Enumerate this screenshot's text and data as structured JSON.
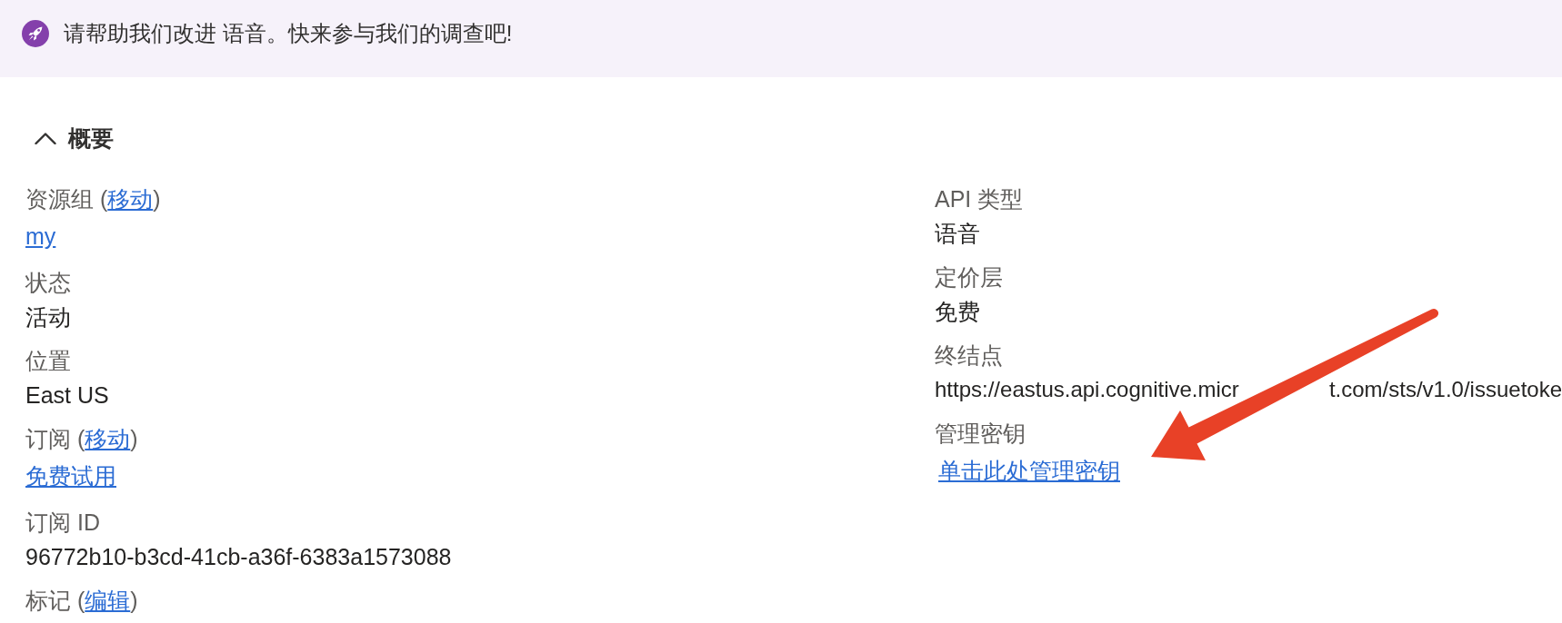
{
  "banner": {
    "message": "请帮助我们改进 语音。快来参与我们的调查吧!"
  },
  "section": {
    "title": "概要",
    "expanded": true
  },
  "left_fields": [
    {
      "label_parts": [
        {
          "kind": "text",
          "text": "资源组 ("
        },
        {
          "kind": "link",
          "text": "移动"
        },
        {
          "kind": "text",
          "text": ")"
        }
      ],
      "kind": "link",
      "value": "my"
    },
    {
      "label_parts": [
        {
          "kind": "text",
          "text": "状态"
        }
      ],
      "kind": "text",
      "value": "活动"
    },
    {
      "label_parts": [
        {
          "kind": "text",
          "text": "位置"
        }
      ],
      "kind": "text",
      "value": "East US"
    },
    {
      "label_parts": [
        {
          "kind": "text",
          "text": "订阅 ("
        },
        {
          "kind": "link",
          "text": "移动"
        },
        {
          "kind": "text",
          "text": ")"
        }
      ],
      "kind": "link",
      "value": "免费试用"
    },
    {
      "label_parts": [
        {
          "kind": "text",
          "text": "订阅 ID"
        }
      ],
      "kind": "text",
      "value": "96772b10-b3cd-41cb-a36f-6383a1573088"
    },
    {
      "label_parts": [
        {
          "kind": "text",
          "text": "标记 ("
        },
        {
          "kind": "link",
          "text": "编辑"
        },
        {
          "kind": "text",
          "text": ")"
        }
      ],
      "kind": "label"
    }
  ],
  "right_fields": [
    {
      "label_parts": [
        {
          "kind": "text",
          "text": "API 类型"
        }
      ],
      "kind": "text",
      "value": "语音"
    },
    {
      "label_parts": [
        {
          "kind": "text",
          "text": "定价层"
        }
      ],
      "kind": "text",
      "value": "免费"
    },
    {
      "label_parts": [
        {
          "kind": "text",
          "text": "终结点"
        }
      ],
      "kind": "covered",
      "value_parts": [
        "https://eastus.api.cognitive.micr",
        "t.com/sts/v1.0/issuetoke"
      ]
    },
    {
      "label_parts": [
        {
          "kind": "text",
          "text": "管理密钥"
        }
      ],
      "kind": "link",
      "value": "单击此处管理密钥"
    }
  ]
}
